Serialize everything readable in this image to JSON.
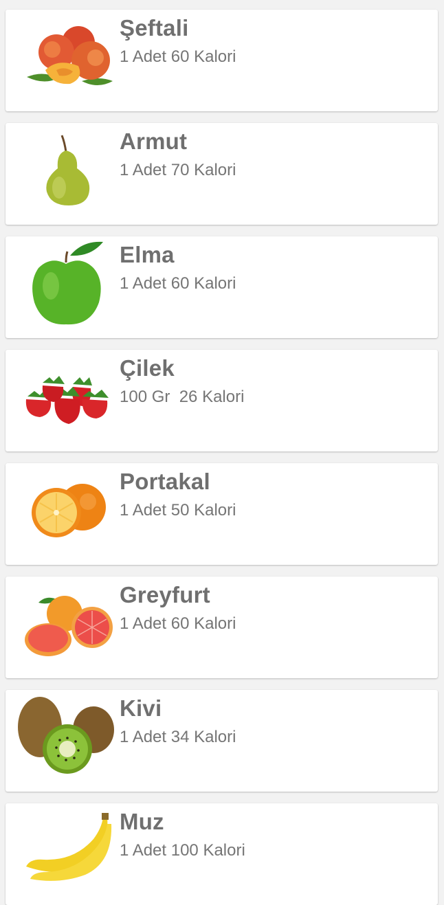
{
  "fruits": [
    {
      "name": "Şeftali",
      "calories": "1 Adet 60 Kalori"
    },
    {
      "name": "Armut",
      "calories": "1 Adet 70 Kalori"
    },
    {
      "name": "Elma",
      "calories": "1 Adet 60 Kalori"
    },
    {
      "name": "Çilek",
      "calories": "100 Gr  26 Kalori"
    },
    {
      "name": "Portakal",
      "calories": "1 Adet 50 Kalori"
    },
    {
      "name": "Greyfurt",
      "calories": "1 Adet 60 Kalori"
    },
    {
      "name": "Kivi",
      "calories": "1 Adet 34 Kalori"
    },
    {
      "name": "Muz",
      "calories": "1 Adet 100 Kalori"
    }
  ],
  "colors": {
    "title": "#6f6f6f",
    "subtitle": "#757575",
    "card": "#ffffff",
    "background": "#f2f2f2"
  }
}
